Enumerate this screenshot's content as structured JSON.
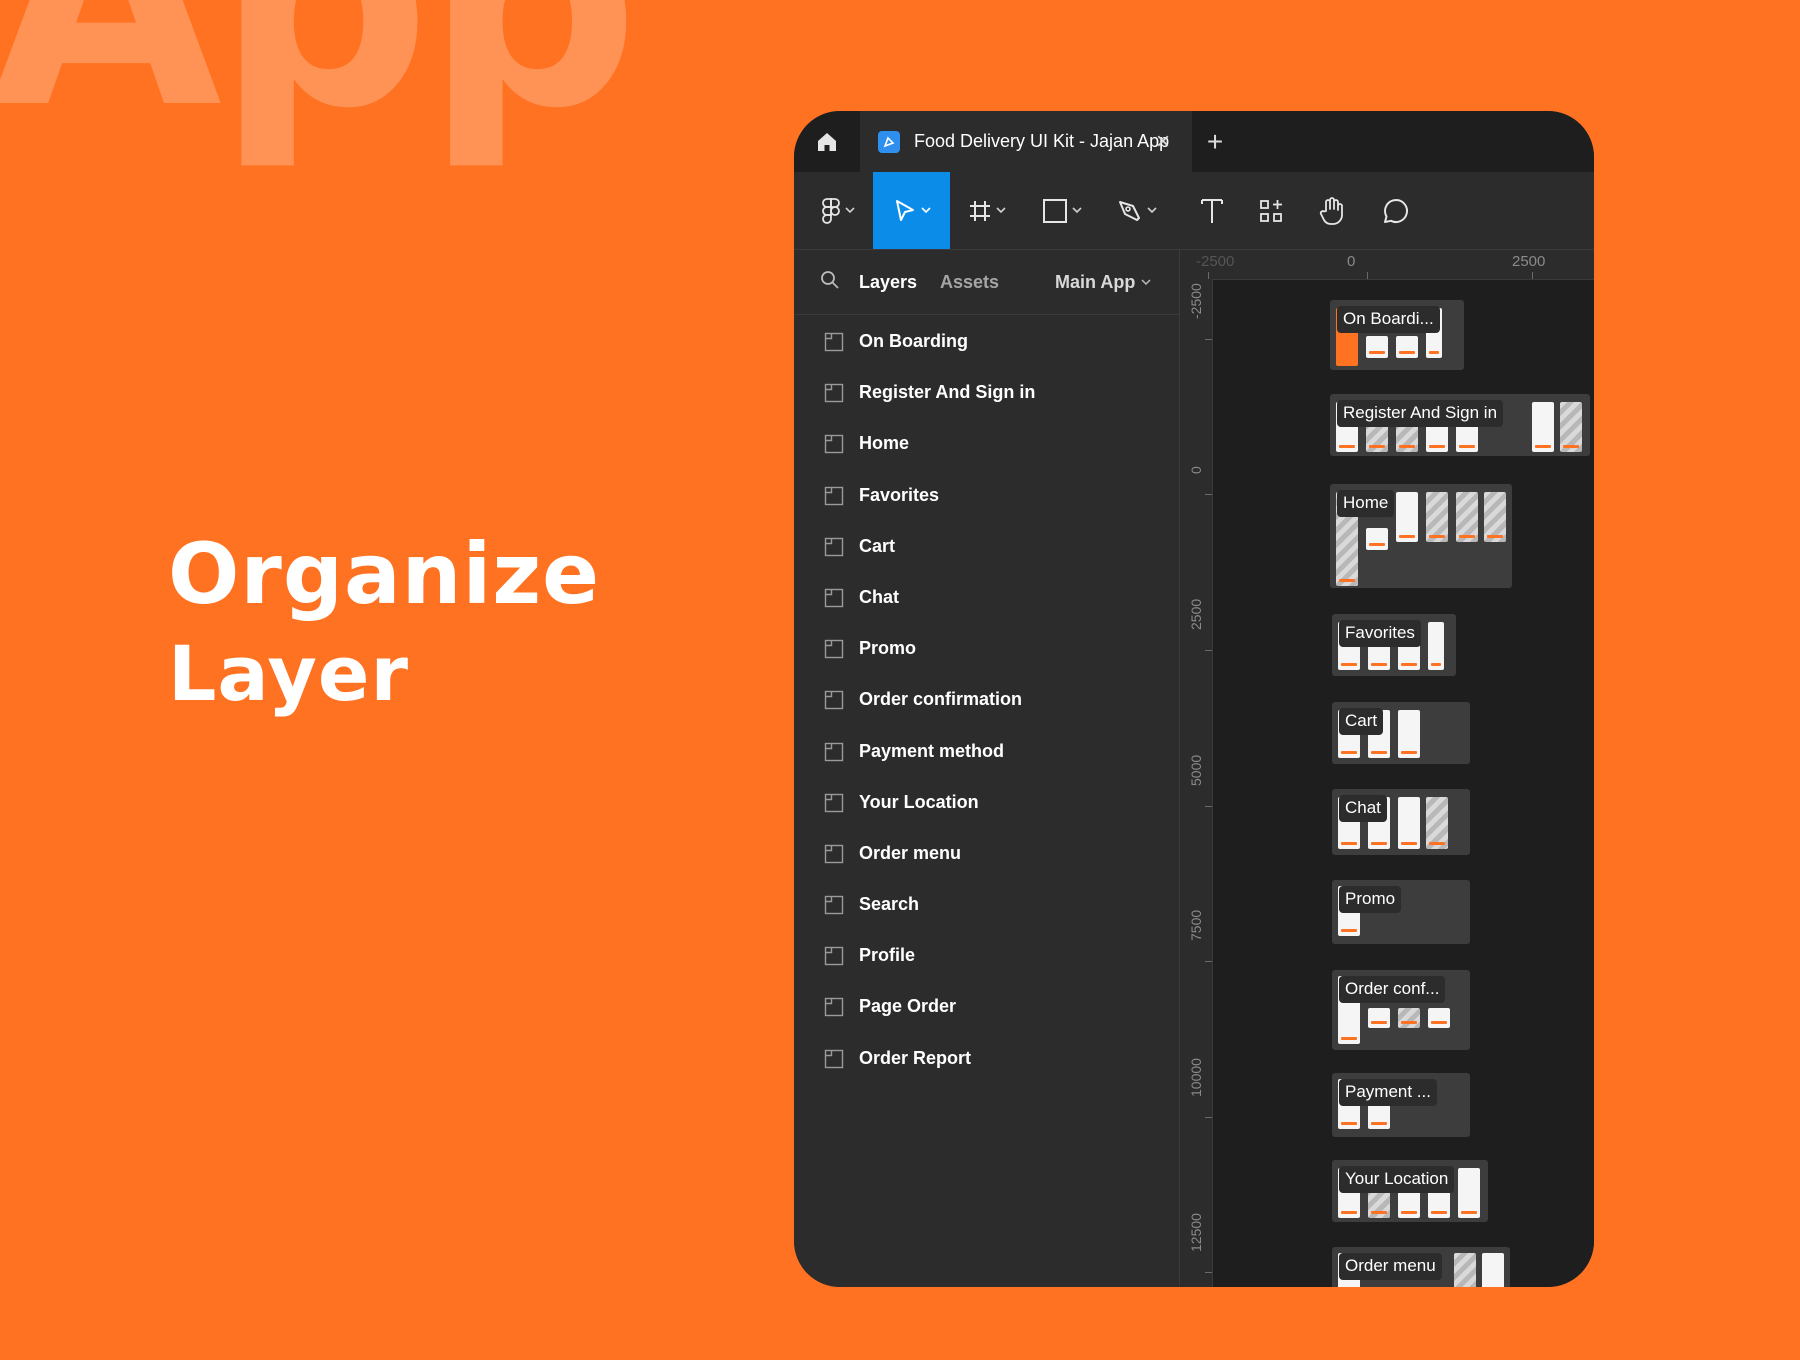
{
  "hero": {
    "bg_word": "App",
    "headline_line1": "Organize",
    "headline_line2": "Layer"
  },
  "app": {
    "tabbar": {
      "home_icon": "home-icon",
      "file_icon": "figma-file-icon",
      "file_title": "Food Delivery UI Kit - Jajan App",
      "close_glyph": "×",
      "new_tab_glyph": "+"
    },
    "toolbar": {
      "tools": [
        "main-menu",
        "move",
        "frame",
        "shape",
        "pen",
        "text",
        "resources",
        "hand",
        "comment"
      ],
      "active_tool": "move"
    },
    "sidebar": {
      "tabs": {
        "layers": "Layers",
        "assets": "Assets"
      },
      "page_selector": "Main App",
      "layers": [
        "On Boarding",
        "Register And Sign in",
        "Home",
        "Favorites",
        "Cart",
        "Chat",
        "Promo",
        "Order confirmation",
        "Payment method",
        "Your Location",
        "Order menu",
        "Search",
        "Profile",
        "Page Order",
        "Order Report"
      ]
    },
    "canvas": {
      "ruler_top": [
        "-2500",
        "0",
        "2500"
      ],
      "ruler_left": [
        "-2500",
        "0",
        "2500",
        "5000",
        "7500",
        "10000",
        "12500"
      ],
      "frames": [
        "On Boardi...",
        "Register And Sign in",
        "Home",
        "Favorites",
        "Cart",
        "Chat",
        "Promo",
        "Order conf...",
        "Payment ...",
        "Your Location",
        "Order menu"
      ]
    },
    "colors": {
      "brand_orange": "#FF7222",
      "active_tool_blue": "#0C8CE9",
      "panel_dark": "#2C2C2C",
      "canvas_dark": "#1E1E1E"
    }
  }
}
